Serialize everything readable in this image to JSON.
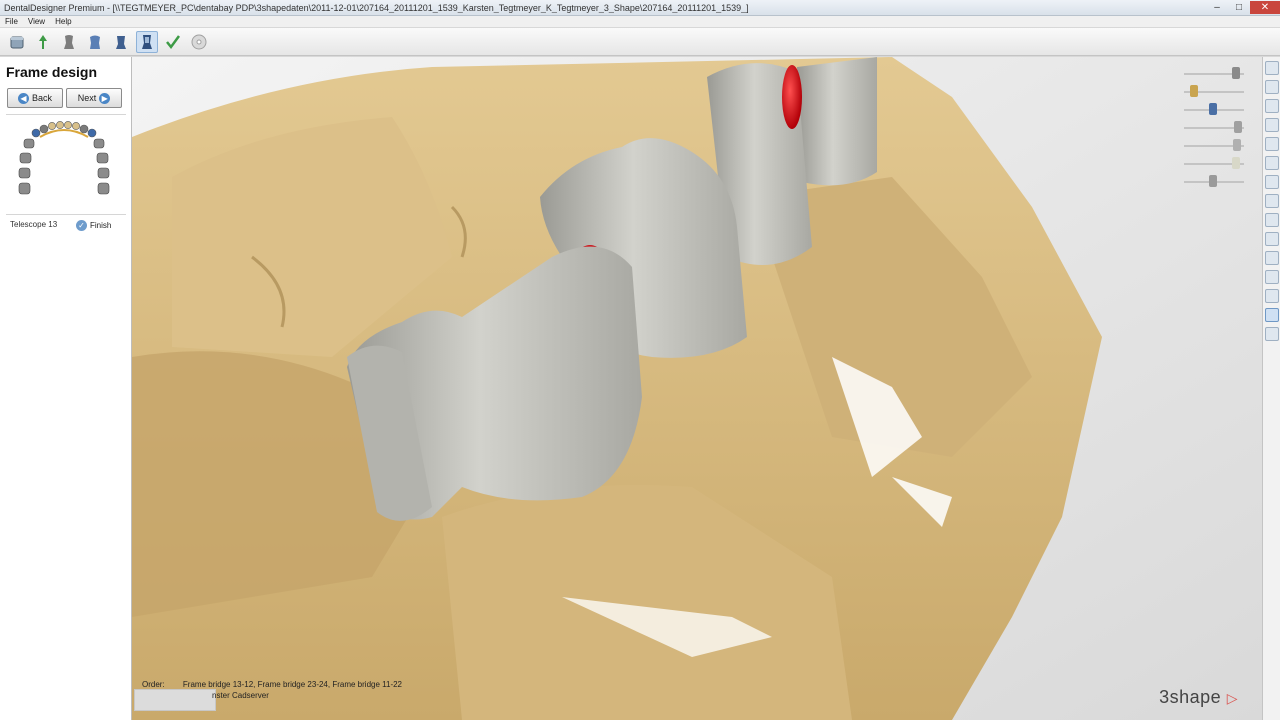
{
  "window": {
    "title": "DentalDesigner Premium - [\\\\TEGTMEYER_PC\\dentabay PDP\\3shapedaten\\2011-12-01\\207164_20111201_1539_Karsten_Tegtmeyer_K_Tegtmeyer_3_Shape\\207164_20111201_1539_]",
    "minimize": "–",
    "maximize": "□",
    "close": "✕"
  },
  "menu": [
    "File",
    "View",
    "Help"
  ],
  "toolbar": {
    "icons": [
      "database-icon",
      "prep-line-icon",
      "die-icon",
      "crown-icon",
      "telescope-icon",
      "frame-design-icon",
      "check-icon",
      "disc-icon"
    ],
    "active_index": 5
  },
  "panel": {
    "title": "Frame design",
    "back_label": "Back",
    "next_label": "Next",
    "tooth_label": "Telescope 13",
    "finish_label": "Finish"
  },
  "viewport": {
    "order_label": "Order:",
    "order_items": [
      "Frame bridge 13-12,",
      "Frame bridge 23-24,",
      "Frame bridge 11-22"
    ],
    "cadserver_text": "nster Cadserver",
    "brand": "3shape",
    "brand_mark": "▷"
  },
  "sliders": [
    {
      "name": "die-opacity",
      "value": 0.85
    },
    {
      "name": "gingiva-opacity",
      "value": 0.1
    },
    {
      "name": "coping-opacity",
      "value": 0.45
    },
    {
      "name": "antagonist-opacity",
      "value": 0.9
    },
    {
      "name": "model-opacity",
      "value": 0.88
    },
    {
      "name": "scan-opacity",
      "value": 0.85
    },
    {
      "name": "texture-opacity",
      "value": 0.45
    }
  ],
  "right_toolbar": {
    "count": 15,
    "active_index": 13
  },
  "colors": {
    "model": "#dcc089",
    "coping": "#c4c4bd",
    "marker": "#d10f14",
    "accent": "#4a86c6"
  }
}
